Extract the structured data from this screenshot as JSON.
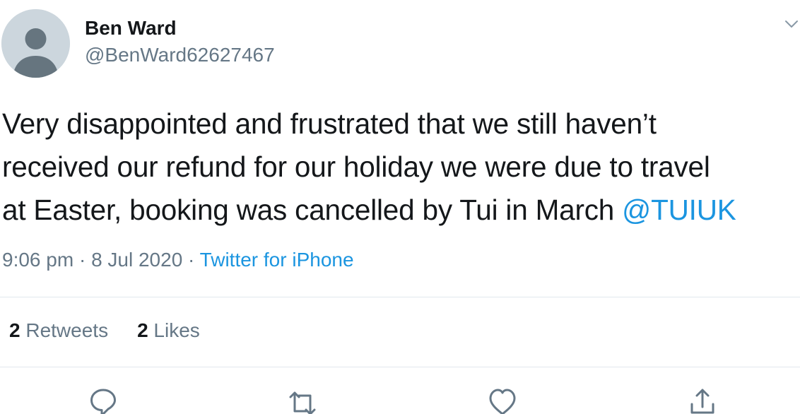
{
  "author": {
    "display_name": "Ben Ward",
    "handle": "@BenWard62627467",
    "avatar_icon": "default-profile-silhouette"
  },
  "tweet": {
    "lines": [
      "Very disappointed and frustrated that we still haven’t",
      "received our refund for our holiday we were due to travel",
      "at Easter, booking was cancelled by Tui in March "
    ],
    "mention": "@TUIUK"
  },
  "meta": {
    "time": "9:06 pm",
    "separator_1": " · ",
    "date": "8 Jul 2020",
    "separator_2": " · ",
    "source": "Twitter for iPhone"
  },
  "stats": {
    "retweets_count": "2",
    "retweets_label": " Retweets",
    "likes_count": "2",
    "likes_label": " Likes"
  },
  "actions": {
    "reply_icon": "reply-icon",
    "retweet_icon": "retweet-icon",
    "like_icon": "heart-icon",
    "share_icon": "share-icon"
  },
  "colors": {
    "link": "#1b95e0",
    "secondary_text": "#657786",
    "primary_text": "#14171a",
    "divider": "#e1e8ed",
    "avatar_bg": "#ccd6dd",
    "avatar_fg": "#66757f"
  }
}
